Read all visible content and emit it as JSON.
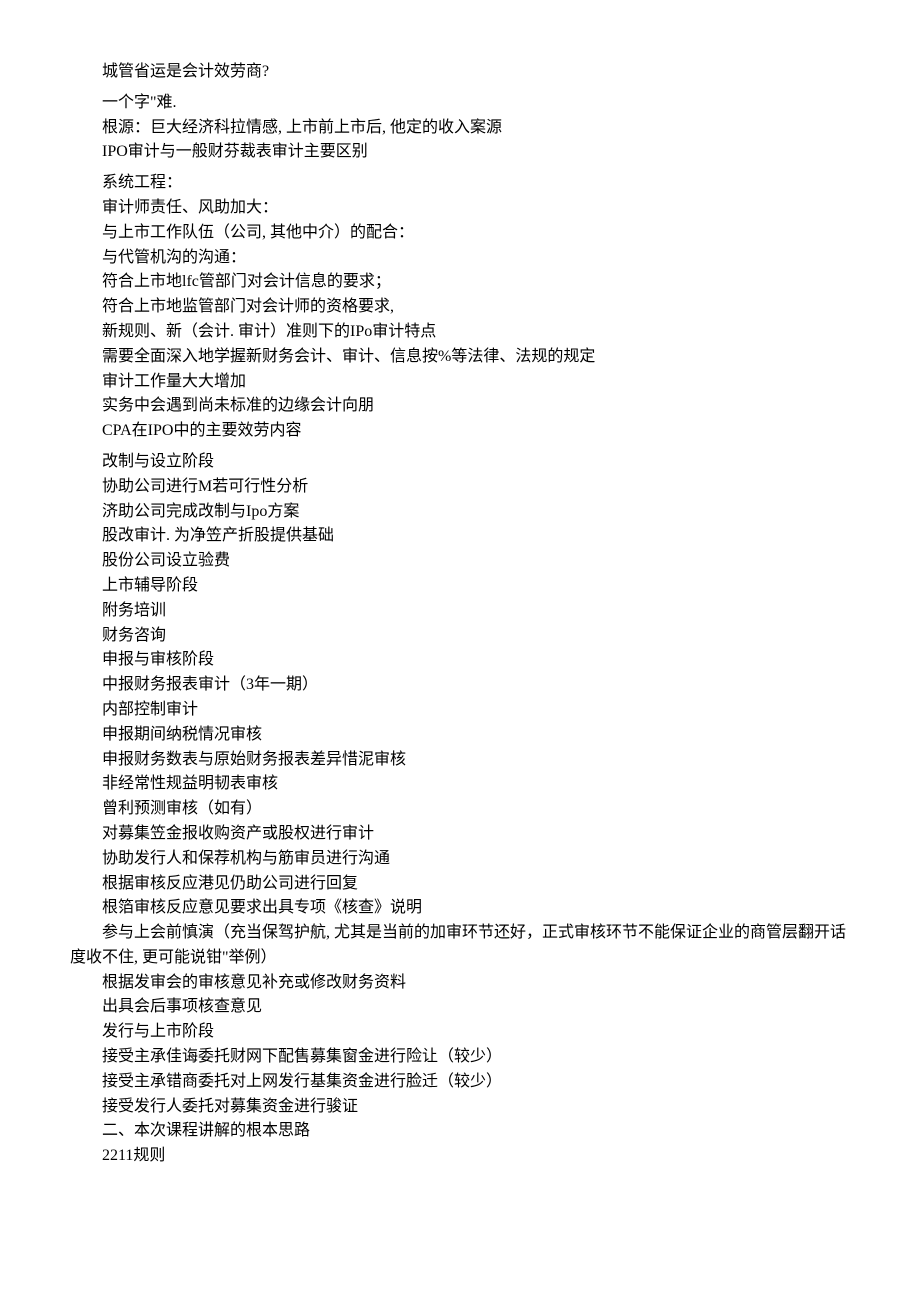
{
  "lines": [
    {
      "text": "城管省运是会计效劳商?",
      "gap": false
    },
    {
      "text": "一个字\"难.",
      "gap": true
    },
    {
      "text": "根源：巨大经济科拉情感, 上市前上市后, 他定的收入案源",
      "gap": false
    },
    {
      "text": "IPO审计与一般财芬裁表审计主要区别",
      "gap": false
    },
    {
      "text": "系统工程：",
      "gap": true
    },
    {
      "text": "审计师责任、风助加大：",
      "gap": false
    },
    {
      "text": "与上市工作队伍（公司, 其他中介）的配合：",
      "gap": false
    },
    {
      "text": "与代管机沟的沟通：",
      "gap": false
    },
    {
      "text": "符合上市地lfc管部门对会计信息的要求；",
      "gap": false
    },
    {
      "text": "符合上市地监管部门对会计师的资格要求,",
      "gap": false
    },
    {
      "text": "新规则、新（会计. 审计）准则下的IPo审计特点",
      "gap": false
    },
    {
      "text": "需要全面深入地学握新财务会计、审计、信息按%等法律、法规的规定",
      "gap": false
    },
    {
      "text": "审计工作量大大增加",
      "gap": false
    },
    {
      "text": "实务中会遇到尚未标准的边缘会计向朋",
      "gap": false
    },
    {
      "text": "CPA在IPO中的主要效劳内容",
      "gap": false
    },
    {
      "text": "改制与设立阶段",
      "gap": true
    },
    {
      "text": "协助公司进行M若可行性分析",
      "gap": false
    },
    {
      "text": "济助公司完成改制与Ipo方案",
      "gap": false
    },
    {
      "text": "股改审计. 为净笠产折股提供基础",
      "gap": false
    },
    {
      "text": "股份公司设立验费",
      "gap": false
    },
    {
      "text": "上市辅导阶段",
      "gap": false
    },
    {
      "text": "附务培训",
      "gap": false
    },
    {
      "text": "财务咨询",
      "gap": false
    },
    {
      "text": "申报与审核阶段",
      "gap": false
    },
    {
      "text": "中报财务报表审计（3年一期）",
      "gap": false
    },
    {
      "text": "内部控制审计",
      "gap": false
    },
    {
      "text": "申报期间纳税情况审核",
      "gap": false
    },
    {
      "text": "申报财务数表与原始财务报表差异惜泥审核",
      "gap": false
    },
    {
      "text": "非经常性规益明韧表审核",
      "gap": false
    },
    {
      "text": "曾利预测审核（如有）",
      "gap": false
    },
    {
      "text": "对募集笠金报收购资产或股权进行审计",
      "gap": false
    },
    {
      "text": "协助发行人和保荐机构与筋审员进行沟通",
      "gap": false
    },
    {
      "text": "根据审核反应港见仍助公司进行回复",
      "gap": false
    },
    {
      "text": "根箔审核反应意见要求出具专项《核查》说明",
      "gap": false
    },
    {
      "text": "参与上会前慎演（充当保驾护航, 尤其是当前的加审环节还好，正式审核环节不能保证企业的商管层翻开话",
      "gap": false
    },
    {
      "text": "度收不住, 更可能说钳\"举例）",
      "gap": false,
      "noindent": true
    },
    {
      "text": "根据发审会的审核意见补充或修改财务资料",
      "gap": false
    },
    {
      "text": "出具会后事项核查意见",
      "gap": false
    },
    {
      "text": "发行与上市阶段",
      "gap": false
    },
    {
      "text": "接受主承佳诲委托财网下配售募集窗金进行险让（较少）",
      "gap": false
    },
    {
      "text": "接受主承错商委托对上网发行基集资金进行脸迁（较少）",
      "gap": false
    },
    {
      "text": "接受发行人委托对募集资金进行骏证",
      "gap": false
    },
    {
      "text": "二、本次课程讲解的根本思路",
      "gap": false
    },
    {
      "text": "2211规则",
      "gap": false
    }
  ]
}
